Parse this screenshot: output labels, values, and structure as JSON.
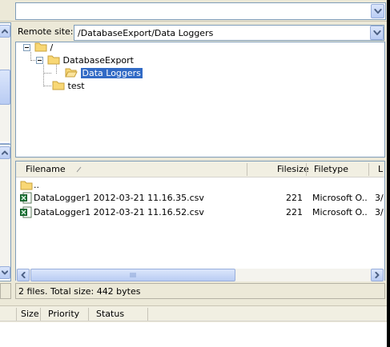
{
  "remote": {
    "label": "Remote site:",
    "path": "/DatabaseExport/Data Loggers"
  },
  "tree": {
    "root": "/",
    "items": [
      {
        "label": "DatabaseExport"
      },
      {
        "label": "Data Loggers"
      },
      {
        "label": "test"
      }
    ]
  },
  "list": {
    "columns": [
      "Filename",
      "Filesize",
      "Filetype",
      "L"
    ],
    "parent_entry": "..",
    "rows": [
      {
        "name": "DataLogger1 2012-03-21 11.16.35.csv",
        "size": "221",
        "type": "Microsoft O...",
        "last": "3/"
      },
      {
        "name": "DataLogger1 2012-03-21 11.16.52.csv",
        "size": "221",
        "type": "Microsoft O...",
        "last": "3/"
      }
    ]
  },
  "status": {
    "text": "2 files. Total size: 442 bytes"
  },
  "queue": {
    "columns": [
      "Size",
      "Priority",
      "Status"
    ]
  },
  "colors": {
    "selection": "#316ac5",
    "panel": "#ece9d8",
    "border": "#7f9db9"
  }
}
